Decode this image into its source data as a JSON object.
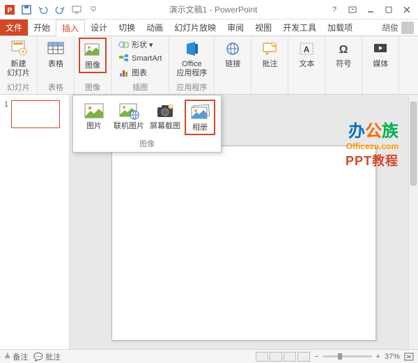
{
  "title": "演示文稿1 - PowerPoint",
  "tabs": {
    "file": "文件",
    "home": "开始",
    "insert": "插入",
    "design": "设计",
    "transitions": "切换",
    "animations": "动画",
    "slideshow": "幻灯片放映",
    "review": "审阅",
    "view": "视图",
    "developer": "开发工具",
    "addins": "加载项",
    "user": "胡俊"
  },
  "ribbon": {
    "slides": {
      "new_slide": "新建\n幻灯片",
      "group": "幻灯片"
    },
    "tables": {
      "table": "表格",
      "group": "表格"
    },
    "images": {
      "image": "图像",
      "group": "图像"
    },
    "illustrations": {
      "shapes": "形状",
      "smartart": "SmartArt",
      "chart": "图表",
      "group": "插图"
    },
    "apps": {
      "office_apps": "Office\n应用程序",
      "group": "应用程序"
    },
    "links": {
      "link": "链接"
    },
    "comments": {
      "comment": "批注"
    },
    "text": {
      "text": "文本"
    },
    "symbols": {
      "symbol": "符号"
    },
    "media": {
      "media": "媒体"
    }
  },
  "dropdown": {
    "picture": "图片",
    "online_picture": "联机图片",
    "screenshot": "屏幕截图",
    "photo_album": "相册",
    "group": "图像"
  },
  "thumbs": {
    "n1": "1"
  },
  "watermark": {
    "line1a": "办",
    "line1b": "公",
    "line1c": "族",
    "line2": "Officezu.com",
    "line3": "PPT教程"
  },
  "status": {
    "notes": "备注",
    "comments": "批注",
    "zoom": "37%"
  }
}
